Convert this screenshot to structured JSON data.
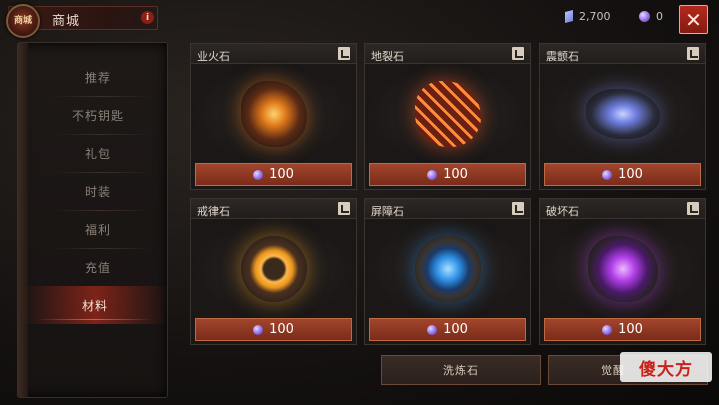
{
  "header": {
    "emblem_label": "商城",
    "title": "商城",
    "info_label": "i",
    "close_label": "✕"
  },
  "currency": {
    "crystal": "2,700",
    "gem": "0"
  },
  "sidebar": {
    "items": [
      {
        "label": "推荐",
        "active": false
      },
      {
        "label": "不朽钥匙",
        "active": false
      },
      {
        "label": "礼包",
        "active": false
      },
      {
        "label": "时装",
        "active": false
      },
      {
        "label": "福利",
        "active": false
      },
      {
        "label": "充值",
        "active": false
      },
      {
        "label": "材料",
        "active": true
      }
    ]
  },
  "items": [
    {
      "name": "业火石",
      "price": "100",
      "icon": "hellfire-stone-icon",
      "color": "#e07a1c"
    },
    {
      "name": "地裂石",
      "price": "100",
      "icon": "earthquake-stone-icon",
      "color": "#e0501c"
    },
    {
      "name": "震颤石",
      "price": "100",
      "icon": "tremor-stone-icon",
      "color": "#6f7fe0"
    },
    {
      "name": "戒律石",
      "price": "100",
      "icon": "discipline-stone-icon",
      "color": "#e8961c"
    },
    {
      "name": "屏障石",
      "price": "100",
      "icon": "barrier-stone-icon",
      "color": "#2e8fe6"
    },
    {
      "name": "破坏石",
      "price": "100",
      "icon": "destruction-stone-icon",
      "color": "#b03ee8"
    }
  ],
  "bottom_tabs": {
    "tab1": "洗炼石",
    "tab2": "觉醒"
  },
  "watermark": "傻大方",
  "colors": {
    "accent_red": "#a2452c",
    "close_red": "#b2291d",
    "active_menu": "#a0281a"
  }
}
